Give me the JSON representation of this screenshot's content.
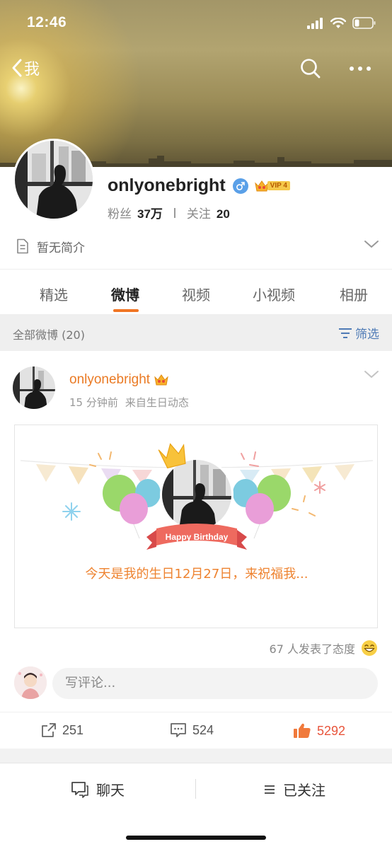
{
  "status_bar": {
    "time": "12:46"
  },
  "nav": {
    "back_label": "我"
  },
  "profile": {
    "name": "onlyonebright",
    "vip_label": "VIP 4",
    "fans_label": "粉丝",
    "fans_count": "37万",
    "following_label": "关注",
    "following_count": "20",
    "bio": "暂无简介"
  },
  "tabs": [
    {
      "label": "精选"
    },
    {
      "label": "微博",
      "active": true
    },
    {
      "label": "视频"
    },
    {
      "label": "小视频"
    },
    {
      "label": "相册"
    }
  ],
  "filter": {
    "count_label": "全部微博 (20)",
    "filter_label": "筛选"
  },
  "post": {
    "author": "onlyonebright",
    "time": "15 分钟前",
    "source": "来自生日动态",
    "card": {
      "banner_text": "Happy Birthday",
      "message": "今天是我的生日12月27日，来祝福我..."
    },
    "attitude_text": "67 人发表了态度",
    "comment_placeholder": "写评论...",
    "reposts": "251",
    "comments": "524",
    "likes": "5292"
  },
  "bottom_bar": {
    "chat_label": "聊天",
    "followed_label": "已关注"
  },
  "colors": {
    "accent": "#f07524",
    "link": "#4f7bb6",
    "like": "#e8553c",
    "author": "#ea7a24"
  }
}
